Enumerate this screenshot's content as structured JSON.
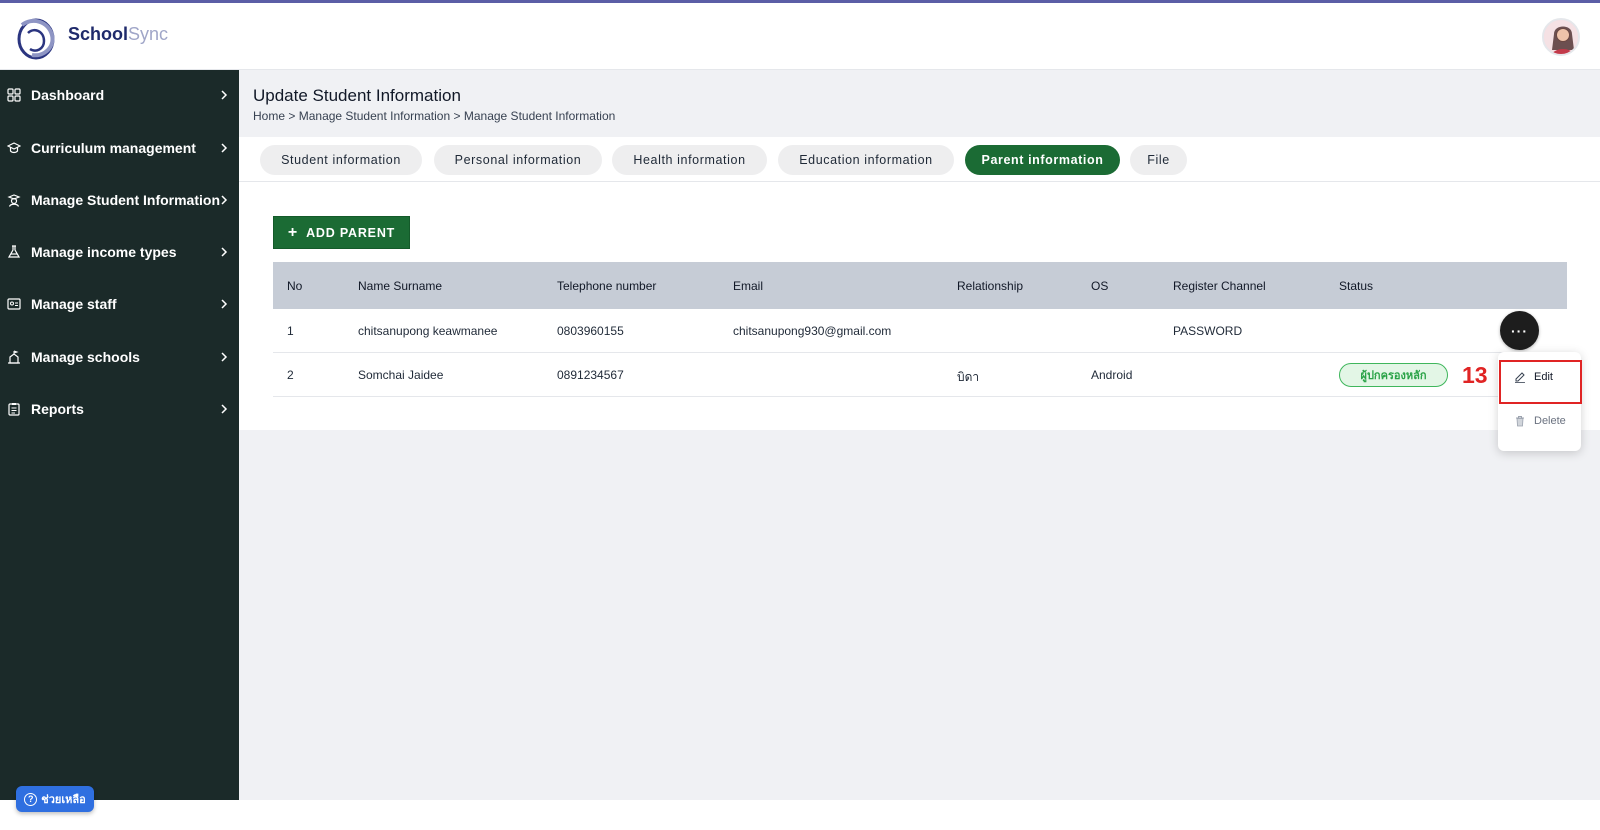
{
  "app": {
    "brand_part1": "School",
    "brand_part2": "Sync"
  },
  "sidebar": {
    "items": [
      {
        "label": "Dashboard",
        "icon": "grid-icon"
      },
      {
        "label": "Curriculum management",
        "icon": "graduation-cap-icon"
      },
      {
        "label": "Manage Student Information",
        "icon": "student-icon"
      },
      {
        "label": "Manage income types",
        "icon": "flask-icon"
      },
      {
        "label": "Manage staff",
        "icon": "id-card-icon"
      },
      {
        "label": "Manage schools",
        "icon": "school-icon"
      },
      {
        "label": "Reports",
        "icon": "clipboard-icon"
      }
    ]
  },
  "page": {
    "title": "Update Student Information",
    "breadcrumb": [
      "Home",
      ">",
      "Manage Student Information",
      ">",
      "Manage Student Information"
    ]
  },
  "tabs": [
    {
      "label": "Student information",
      "active": false
    },
    {
      "label": "Personal information",
      "active": false
    },
    {
      "label": "Health information",
      "active": false
    },
    {
      "label": "Education information",
      "active": false
    },
    {
      "label": "Parent information",
      "active": true
    },
    {
      "label": "File",
      "active": false
    }
  ],
  "toolbar": {
    "add_parent_label": "ADD PARENT"
  },
  "table": {
    "columns": [
      "No",
      "Name Surname",
      "Telephone number",
      "Email",
      "Relationship",
      "OS",
      "Register Channel",
      "Status"
    ],
    "rows": [
      {
        "no": "1",
        "name": "chitsanupong keawmanee",
        "phone": "0803960155",
        "email": "chitsanupong930@gmail.com",
        "relationship": "",
        "os": "",
        "channel": "PASSWORD",
        "status": ""
      },
      {
        "no": "2",
        "name": "Somchai Jaidee",
        "phone": "0891234567",
        "email": "",
        "relationship": "บิดา",
        "os": "Android",
        "channel": "",
        "status": "ผู้ปกครองหลัก"
      }
    ]
  },
  "row_menu": {
    "more_label": "···",
    "edit_label": "Edit",
    "delete_label": "Delete"
  },
  "annotation": {
    "step": "13"
  },
  "help": {
    "label": "ช่วยเหลือ",
    "icon": "?"
  },
  "colors": {
    "sidebar_bg": "#1b2a29",
    "accent_green": "#1b6b34",
    "highlight_red": "#e02424",
    "help_blue": "#2f6fe0"
  }
}
